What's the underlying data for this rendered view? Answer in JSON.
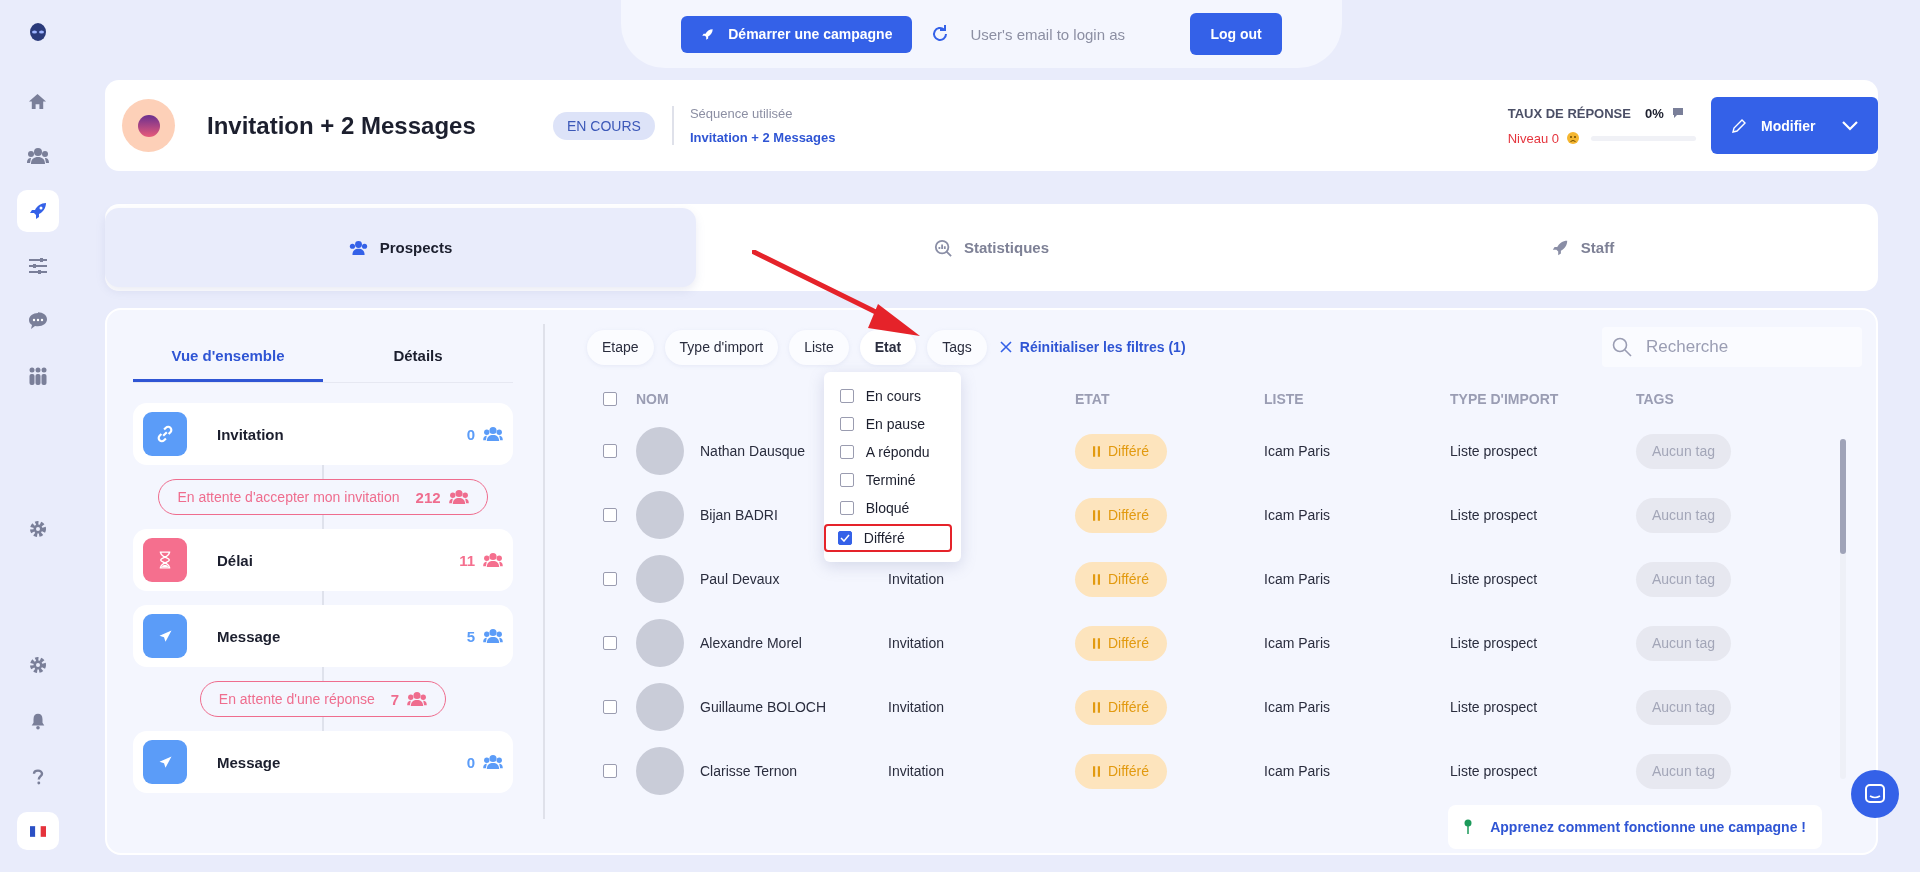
{
  "sidebar": {
    "items": [
      {
        "kind": "home",
        "selected": false
      },
      {
        "kind": "users",
        "selected": false
      },
      {
        "kind": "rocket",
        "selected": true
      },
      {
        "kind": "sliders",
        "selected": false
      },
      {
        "kind": "chat",
        "selected": false
      },
      {
        "kind": "group",
        "selected": false
      },
      {
        "kind": "gear",
        "selected": false
      }
    ],
    "bottom_items": [
      {
        "kind": "gear",
        "selected": false
      },
      {
        "kind": "bell",
        "selected": false
      },
      {
        "kind": "help",
        "selected": false
      },
      {
        "kind": "flag"
      }
    ]
  },
  "top_bar": {
    "start_button": "Démarrer une campagne",
    "login_as_placeholder": "User's email to login as",
    "logout_button": "Log out"
  },
  "campaign": {
    "title": "Invitation + 2 Messages",
    "status": "EN COURS",
    "sequence_label": "Séquence utilisée",
    "sequence_link": "Invitation + 2 Messages",
    "response_rate_label": "TAUX DE RÉPONSE",
    "response_rate": "0%",
    "level_label": "Niveau 0",
    "level": 0,
    "edit_button": "Modifier"
  },
  "tabs": [
    {
      "label": "Prospects",
      "selected": true
    },
    {
      "label": "Statistiques",
      "selected": false
    },
    {
      "label": "Staff",
      "selected": false
    }
  ],
  "overview": {
    "tabs": [
      {
        "label": "Vue d'ensemble",
        "selected": true
      },
      {
        "label": "Détails",
        "selected": false
      }
    ],
    "steps": [
      {
        "kind": "invite",
        "label": "Invitation",
        "count": "0",
        "color": "#5b9cf8"
      },
      {
        "kind": "waiting",
        "label": "En attente d'accepter mon invitation",
        "count": "212"
      },
      {
        "kind": "delay",
        "label": "Délai",
        "count": "11",
        "color": "#f56f8e"
      },
      {
        "kind": "message",
        "label": "Message",
        "count": "5",
        "color": "#5b9cf8"
      },
      {
        "kind": "waiting",
        "label": "En attente d'une réponse",
        "count": "7"
      },
      {
        "kind": "message",
        "label": "Message",
        "count": "0",
        "color": "#5b9cf8"
      }
    ]
  },
  "filters": {
    "chips": [
      {
        "label": "Etape",
        "selected": false
      },
      {
        "label": "Type d'import",
        "selected": false
      },
      {
        "label": "Liste",
        "selected": false
      },
      {
        "label": "Etat",
        "selected": true
      },
      {
        "label": "Tags",
        "selected": false
      }
    ],
    "reset": "Réinitialiser les filtres (1)",
    "search": {
      "placeholder": "Recherche"
    },
    "dropdown": {
      "options": [
        {
          "label": "En cours",
          "checked": false,
          "highlighted": false
        },
        {
          "label": "En pause",
          "checked": false,
          "highlighted": false
        },
        {
          "label": "A répondu",
          "checked": false,
          "highlighted": false
        },
        {
          "label": "Terminé",
          "checked": false,
          "highlighted": false
        },
        {
          "label": "Bloqué",
          "checked": false,
          "highlighted": false
        },
        {
          "label": "Différé",
          "checked": true,
          "highlighted": true
        }
      ]
    }
  },
  "table": {
    "all_checked": false,
    "columns": [
      "NOM",
      "ETAT",
      "LISTE",
      "TYPE D'IMPORT",
      "TAGS"
    ],
    "rows": [
      {
        "checked": false,
        "name": "Nathan Dausque",
        "status": "Différé",
        "list": "Icam Paris",
        "import_type": "Liste prospect",
        "tags": "Aucun tag"
      },
      {
        "checked": false,
        "name": "Bijan BADRI",
        "status": "Différé",
        "list": "Icam Paris",
        "import_type": "Liste prospect",
        "tags": "Aucun tag"
      },
      {
        "checked": false,
        "name": "Paul Devaux",
        "step": "Invitation",
        "status": "Différé",
        "list": "Icam Paris",
        "import_type": "Liste prospect",
        "tags": "Aucun tag"
      },
      {
        "checked": false,
        "name": "Alexandre Morel",
        "step": "Invitation",
        "status": "Différé",
        "list": "Icam Paris",
        "import_type": "Liste prospect",
        "tags": "Aucun tag"
      },
      {
        "checked": false,
        "name": "Guillaume BOLOCH",
        "step": "Invitation",
        "status": "Différé",
        "list": "Icam Paris",
        "import_type": "Liste prospect",
        "tags": "Aucun tag"
      },
      {
        "checked": false,
        "name": "Clarisse Ternon",
        "step": "Invitation",
        "status": "Différé",
        "list": "Icam Paris",
        "import_type": "Liste prospect",
        "tags": "Aucun tag"
      }
    ]
  },
  "help_banner": "Apprenez comment fonctionne une campagne !"
}
